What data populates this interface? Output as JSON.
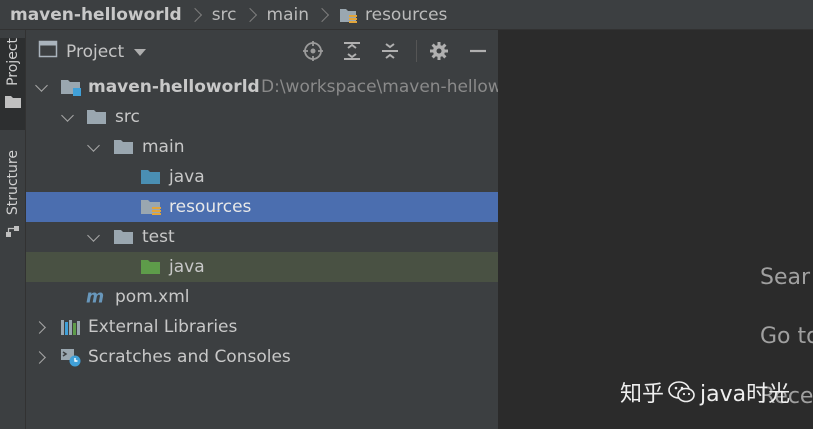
{
  "breadcrumb": {
    "items": [
      "maven-helloworld",
      "src",
      "main",
      "resources"
    ]
  },
  "tool_stripe": {
    "project_tab": "Project",
    "structure_tab": "Structure"
  },
  "panel": {
    "title": "Project",
    "icons": [
      "locate-icon",
      "expand-all-icon",
      "collapse-all-icon",
      "gear-icon",
      "hide-icon"
    ]
  },
  "tree": {
    "root": {
      "label": "maven-helloworld",
      "path": "D:\\workspace\\maven-hellow"
    },
    "src": "src",
    "main": "main",
    "main_java": "java",
    "resources": "resources",
    "test": "test",
    "test_java": "java",
    "pom": "pom.xml",
    "external_libraries": "External Libraries",
    "scratches": "Scratches and Consoles"
  },
  "editor": {
    "hints": [
      "Sear",
      "Go to",
      "Rece"
    ]
  },
  "watermark": {
    "text_left": "知乎",
    "text_right": "java时光"
  },
  "colors": {
    "selection": "#4b6eaf",
    "test_highlight": "#495143",
    "source_folder": "#4a8fb3",
    "test_folder": "#5e9c4a",
    "maven_m": "#6897bb"
  }
}
